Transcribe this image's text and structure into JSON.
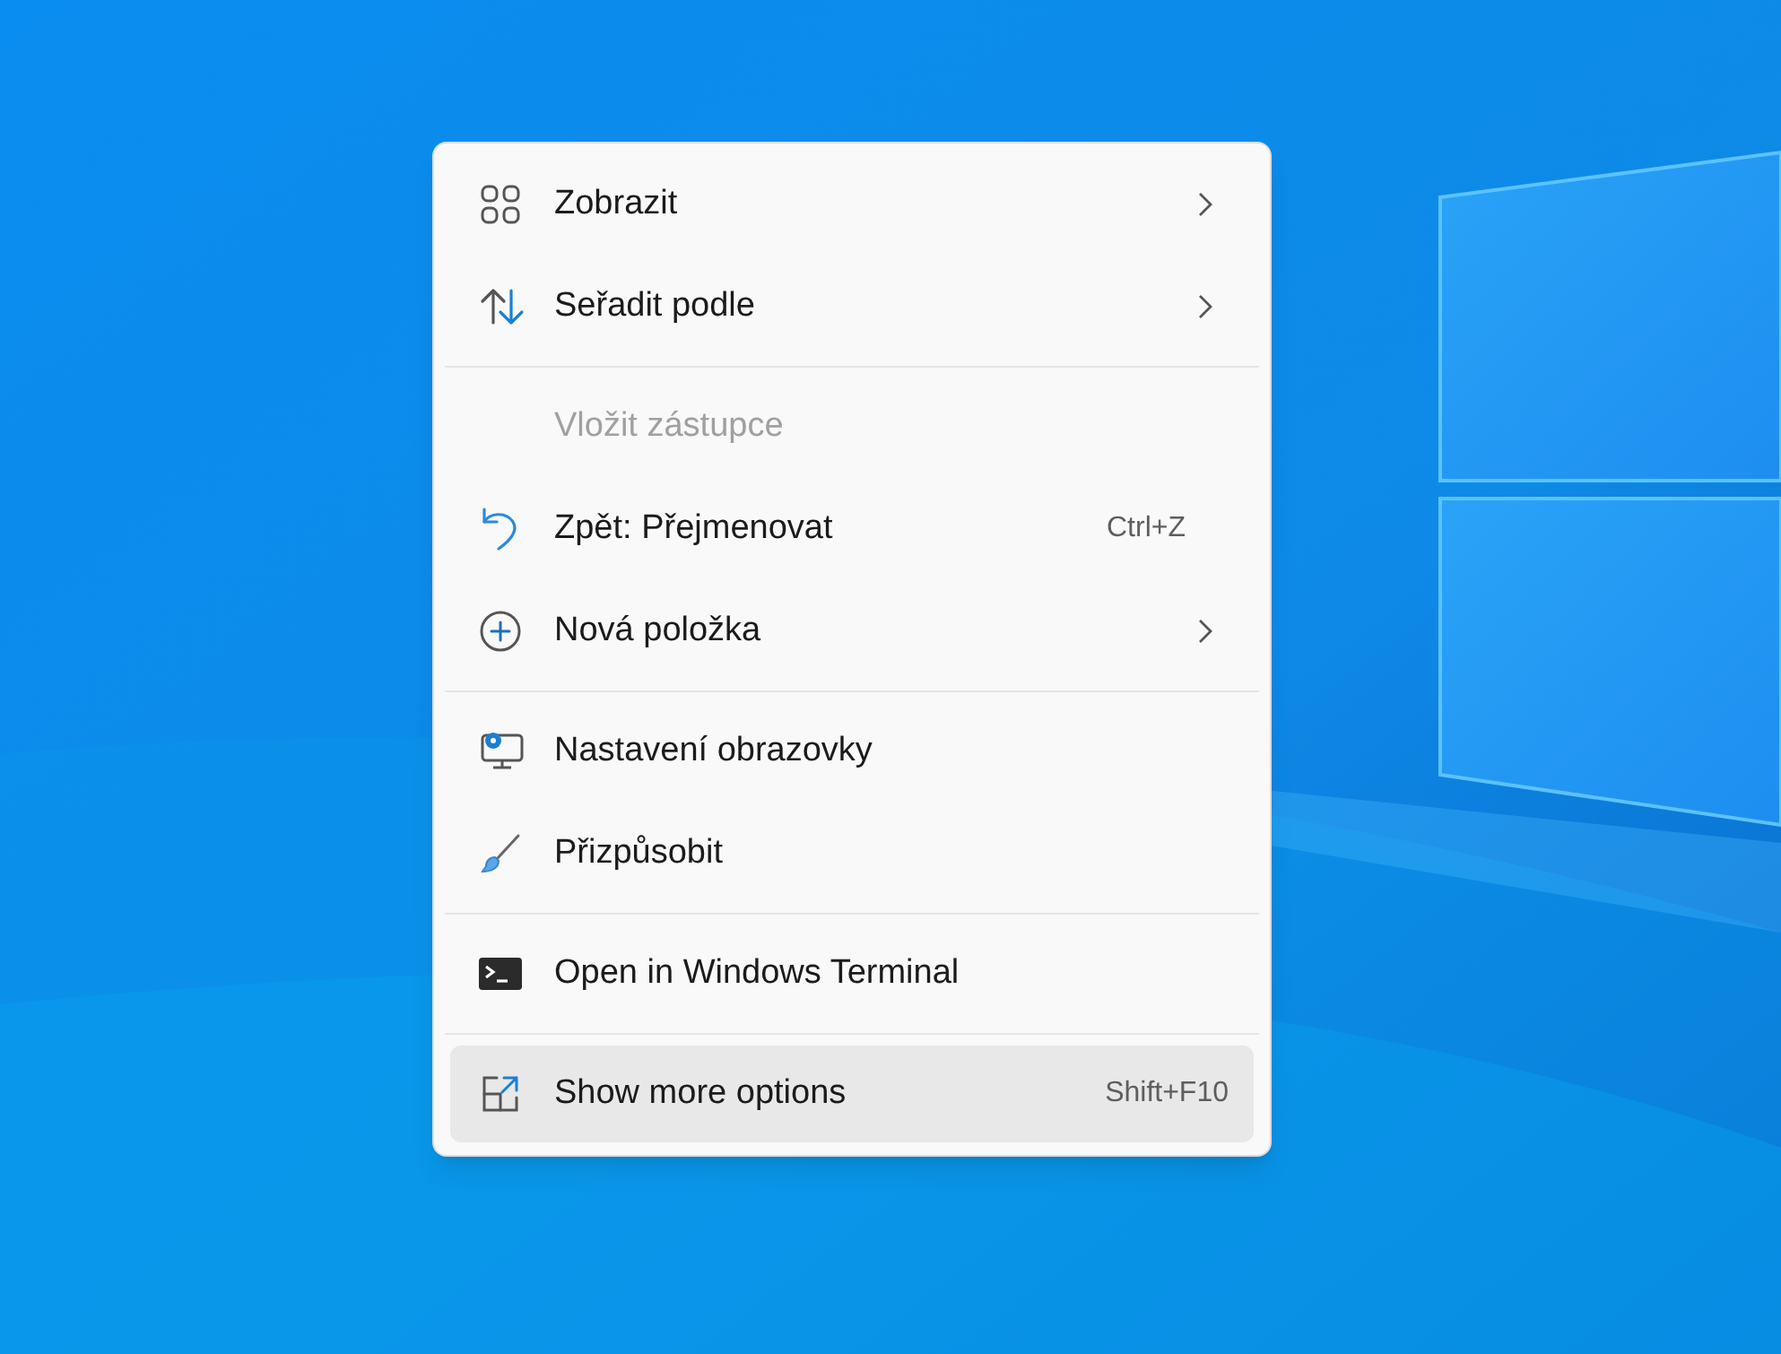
{
  "menu": {
    "groups": [
      {
        "items": [
          {
            "kind": "grid",
            "label": "Zobrazit",
            "submenu": true,
            "disabled": false,
            "selected": false
          },
          {
            "kind": "sort",
            "label": "Seřadit podle",
            "submenu": true,
            "disabled": false,
            "selected": false
          }
        ]
      },
      {
        "items": [
          {
            "kind": "plain",
            "label": "Vložit zástupce",
            "submenu": false,
            "disabled": true,
            "selected": false
          },
          {
            "kind": "undo",
            "label": "Zpět: Přejmenovat",
            "shortcut": "Ctrl+Z",
            "submenu": false,
            "disabled": false,
            "selected": false
          },
          {
            "kind": "add",
            "label": "Nová položka",
            "submenu": true,
            "disabled": false,
            "selected": false
          }
        ]
      },
      {
        "items": [
          {
            "kind": "display",
            "label": "Nastavení obrazovky",
            "submenu": false,
            "disabled": false,
            "selected": false
          },
          {
            "kind": "brush",
            "label": "Přizpůsobit",
            "submenu": false,
            "disabled": false,
            "selected": false
          }
        ]
      },
      {
        "items": [
          {
            "kind": "terminal",
            "label": "Open in Windows Terminal",
            "submenu": false,
            "disabled": false,
            "selected": false
          }
        ]
      },
      {
        "items": [
          {
            "kind": "more",
            "label": "Show more options",
            "shortcut": "Shift+F10",
            "submenu": false,
            "disabled": false,
            "selected": true
          }
        ]
      }
    ]
  }
}
